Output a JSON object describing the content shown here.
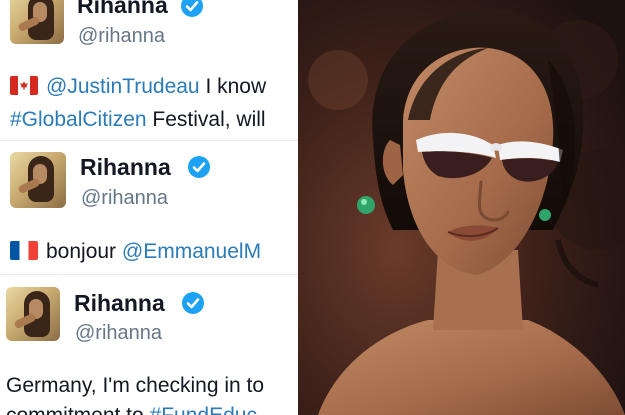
{
  "tweets": [
    {
      "name": "Rihanna",
      "handle": "@rihanna",
      "flag": "canada-flag",
      "mention": "@JustinTrudeau",
      "text_after_mention": " I know",
      "hashtag": "#GlobalCitizen",
      "text_after_hashtag": " Festival, will"
    },
    {
      "name": "Rihanna",
      "handle": "@rihanna",
      "flag": "france-flag",
      "text_before_mention": "bonjour ",
      "mention": "@EmmanuelM"
    },
    {
      "name": "Rihanna",
      "handle": "@rihanna",
      "body_line1": "Germany, I'm checking in to",
      "body_line2_prefix": "commitment to ",
      "hashtag": "#FundEduc"
    }
  ],
  "colors": {
    "link": "#2b7bb9",
    "verified": "#1da1f2",
    "name": "#141823",
    "handle": "#657786"
  }
}
